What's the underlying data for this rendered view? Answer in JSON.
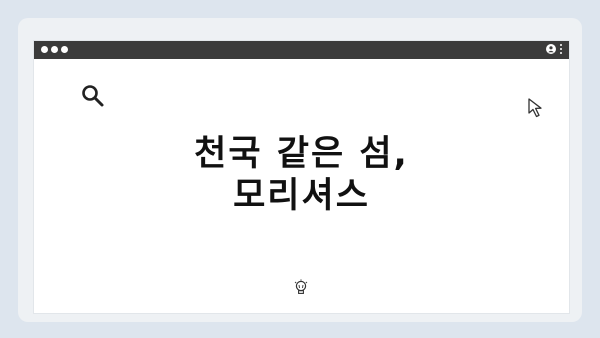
{
  "headline": {
    "line1": "천국 같은 섬,",
    "line2": "모리셔스"
  },
  "icons": {
    "search": "search-icon",
    "cursor": "cursor-arrow-icon",
    "lightbulb": "lightbulb-icon",
    "user": "user-icon",
    "menu": "kebab-menu-icon"
  },
  "colors": {
    "background": "#dde5ee",
    "titlebar": "#3b3b3b",
    "window": "#ffffff",
    "text": "#111111"
  }
}
